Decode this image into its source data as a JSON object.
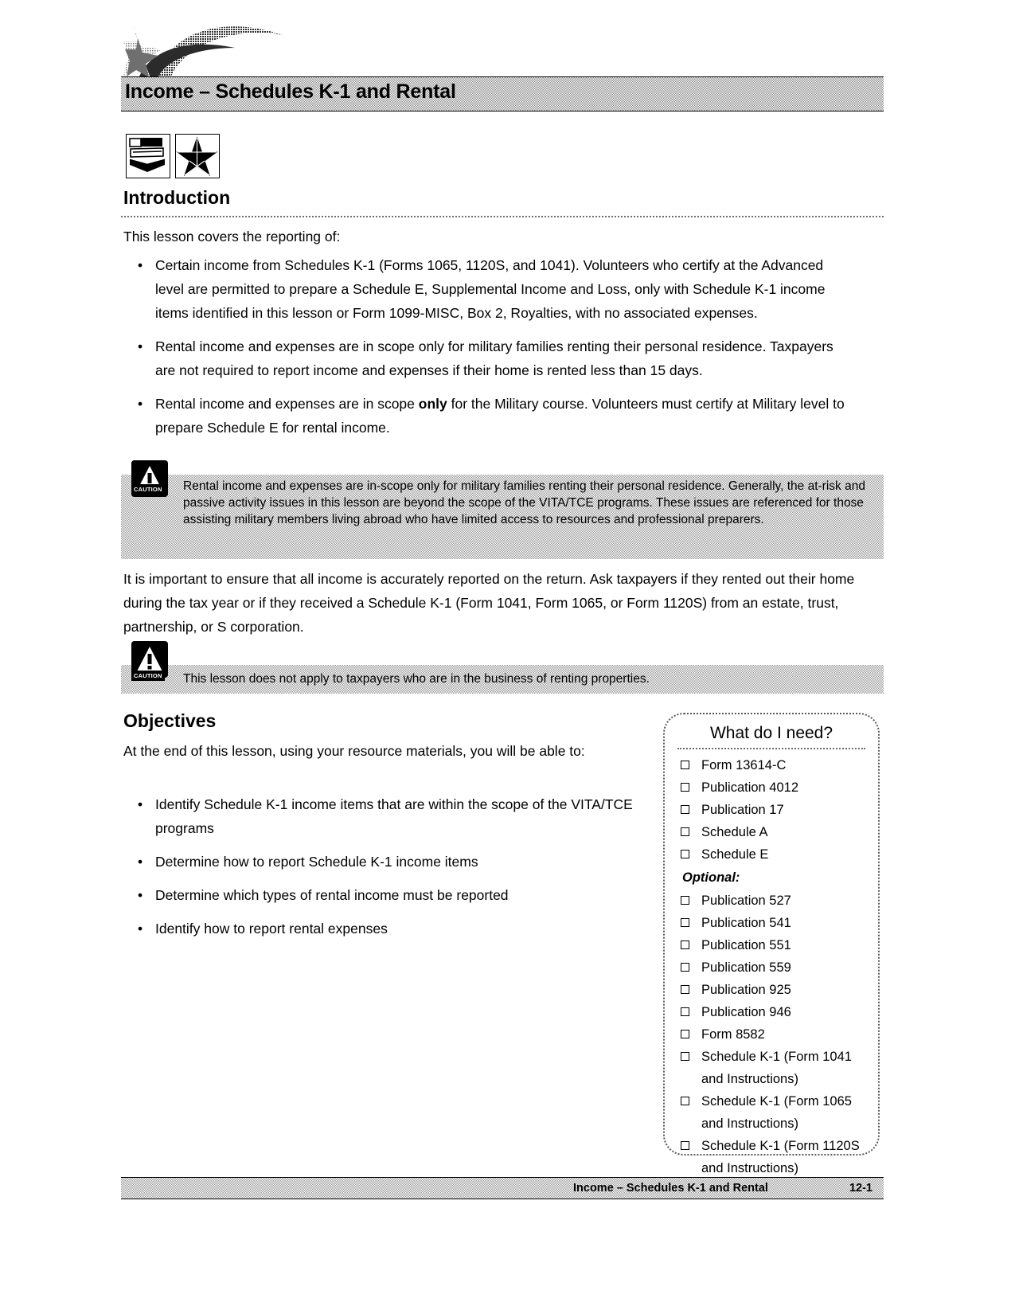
{
  "header": {
    "banner_title": "Income – Schedules K-1 and Rental",
    "icons": [
      "books-icon",
      "star-icon"
    ]
  },
  "introduction": {
    "heading": "Introduction",
    "lead": "This lesson covers the reporting of:",
    "bullets": [
      "Certain income from Schedules K-1 (Forms 1065, 1120S, and 1041). Volunteers who certify at the Advanced level are permitted to prepare a Schedule E, Supplemental Income and Loss, only with Schedule K-1 income items identified in this lesson or Form 1099-MISC, Box 2, Royalties, with no associated expenses.",
      "Rental income and expenses are in scope only for military families renting their personal residence. Taxpayers are not required to report income and expenses if their home is rented less than 15 days."
    ],
    "bullet3_pre": "Rental income and expenses are in scope ",
    "bullet3_bold": "only",
    "bullet3_post": " for the Military course. Volunteers must certify at Military level to prepare Schedule E for rental income."
  },
  "caution1": {
    "tag": "CAUTION",
    "icon": "caution-triangle-icon",
    "text": "Rental income and expenses are in-scope only for military families renting their personal residence. Generally, the at-risk and passive activity issues in this lesson are beyond the scope of the VITA/TCE programs. These issues are referenced for those assisting military members living abroad who have limited access to resources and professional preparers."
  },
  "paragraph": "It is important to ensure that all income is accurately reported on the return. Ask taxpayers if they rented out their home during the tax year or if they received a Schedule K-1 (Form 1041, Form 1065, or Form 1120S) from an estate, trust, partnership, or S corporation.",
  "caution2": {
    "tag": "CAUTION",
    "icon": "caution-triangle-icon",
    "text": "This lesson does not apply to taxpayers who are in the business of renting properties."
  },
  "objectives": {
    "heading": "Objectives",
    "lead": "At the end of this lesson, using your resource materials, you will be able to:",
    "items": [
      "Identify Schedule K-1 income items that are within the scope of the VITA/TCE programs",
      "Determine how to report Schedule K-1 income items",
      "Determine which types of rental income must be reported",
      "Identify how to report rental expenses"
    ]
  },
  "what_do_i_need": {
    "title": "What do I need?",
    "items": [
      {
        "label": "Form 13614-C",
        "checkbox": true
      },
      {
        "label": "Publication 4012",
        "checkbox": true
      },
      {
        "label": "Publication 17",
        "checkbox": true
      },
      {
        "label": "Schedule A",
        "checkbox": true
      },
      {
        "label": "Schedule E",
        "checkbox": true
      },
      {
        "label": "Optional:",
        "checkbox": false,
        "style": "optional"
      },
      {
        "label": "Publication 527",
        "checkbox": true
      },
      {
        "label": "Publication 541",
        "checkbox": true
      },
      {
        "label": "Publication 551",
        "checkbox": true
      },
      {
        "label": "Publication 559",
        "checkbox": true
      },
      {
        "label": "Publication 925",
        "checkbox": true
      },
      {
        "label": "Publication 946",
        "checkbox": true
      },
      {
        "label": "Form 8582",
        "checkbox": true
      },
      {
        "label": "Schedule K-1 (Form 1041",
        "label2": "and Instructions)",
        "checkbox": true
      },
      {
        "label": "Schedule K-1 (Form 1065",
        "label2": "and Instructions)",
        "checkbox": true
      },
      {
        "label": "Schedule K-1 (Form 1120S",
        "label2": "and Instructions)",
        "checkbox": true
      }
    ]
  },
  "footer": {
    "title": "Income – Schedules K-1 and Rental",
    "page": "12-1"
  }
}
